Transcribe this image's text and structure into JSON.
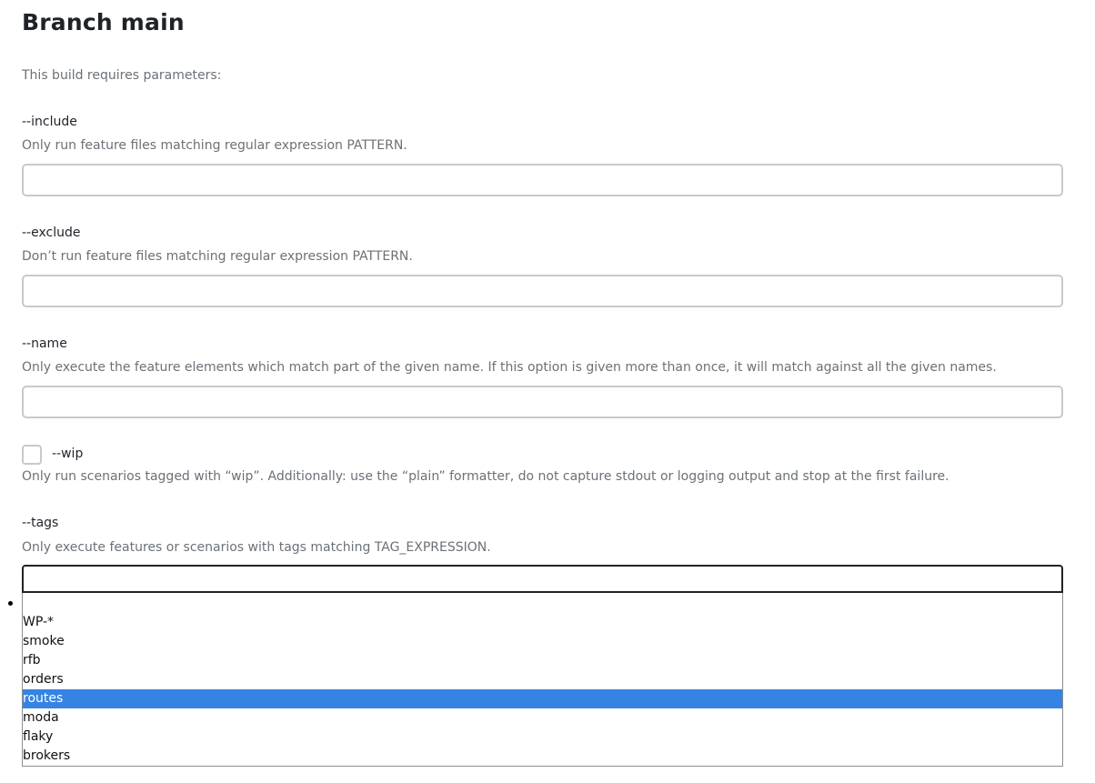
{
  "page": {
    "title": "Branch main",
    "intro": "This build requires parameters:"
  },
  "params": {
    "include": {
      "label": "--include",
      "description": "Only run feature files matching regular expression PATTERN.",
      "value": ""
    },
    "exclude": {
      "label": "--exclude",
      "description": "Don’t run feature files matching regular expression PATTERN.",
      "value": ""
    },
    "name": {
      "label": "--name",
      "description": "Only execute the feature elements which match part of the given name. If this option is given more than once, it will match against all the given names.",
      "value": ""
    },
    "wip": {
      "label": "--wip",
      "description": "Only run scenarios tagged with “wip”. Additionally: use the “plain” formatter, do not capture stdout or logging output and stop at the first failure.",
      "checked": false
    },
    "tags": {
      "label": "--tags",
      "description": "Only execute features or scenarios with tags matching TAG_EXPRESSION.",
      "value": "",
      "suggestions": [
        "WP-*",
        "smoke",
        "rfb",
        "orders",
        "routes",
        "moda",
        "flaky",
        "brokers"
      ],
      "highlighted": "routes"
    }
  },
  "colors": {
    "highlight": "#3584e4",
    "muted_text": "#6b7177",
    "input_border": "#c5cacd"
  }
}
